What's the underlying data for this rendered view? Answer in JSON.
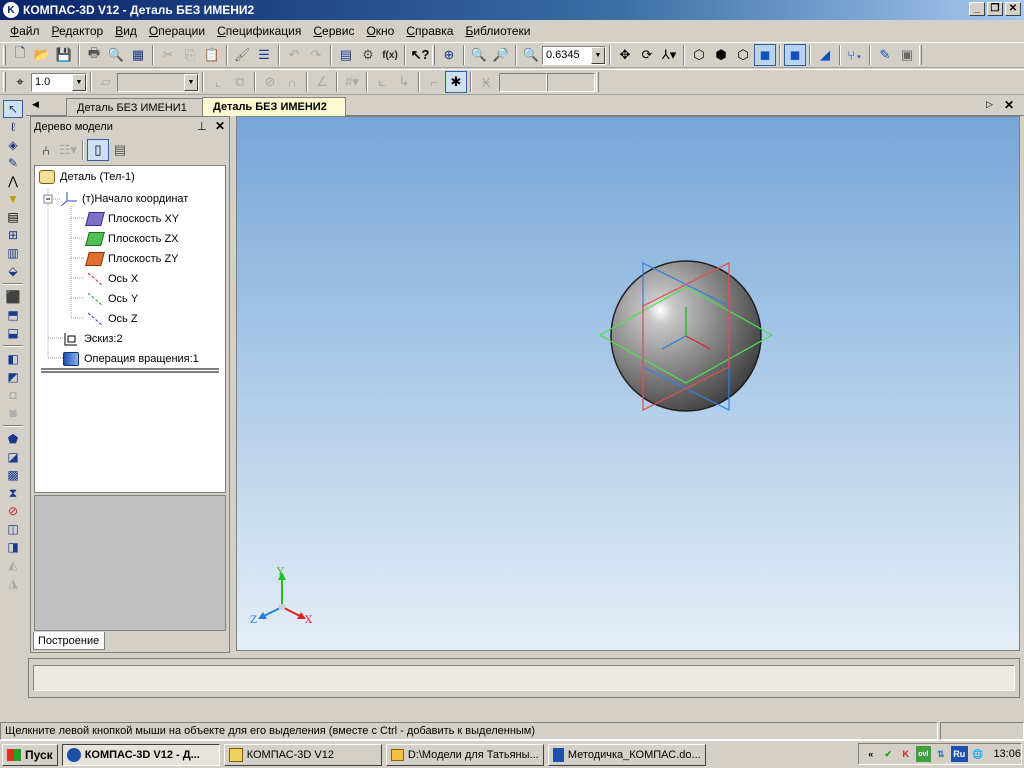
{
  "window": {
    "title": "КОМПАС-3D V12 - Деталь БЕЗ ИМЕНИ2",
    "min_icon": "minimize-icon",
    "restore_icon": "restore-icon",
    "close_icon": "close-icon"
  },
  "menubar": [
    {
      "first": "Ф",
      "rest": "айл"
    },
    {
      "first": "Р",
      "rest": "едактор"
    },
    {
      "first": "В",
      "rest": "ид"
    },
    {
      "first": "О",
      "rest": "перации"
    },
    {
      "first": "С",
      "rest": "пецификация"
    },
    {
      "first": "С",
      "rest": "ервис"
    },
    {
      "first": "О",
      "rest": "кно"
    },
    {
      "first": "С",
      "rest": "правка"
    },
    {
      "first": "Б",
      "rest": "иблиотеки"
    }
  ],
  "toolbar1": {
    "zoom_value": "0.6345",
    "fx_label": "f(x)"
  },
  "toolbar2": {
    "step_value": "1.0"
  },
  "tabs": {
    "tab1": "Деталь БЕЗ ИМЕНИ1",
    "tab2": "Деталь БЕЗ ИМЕНИ2"
  },
  "tree": {
    "title": "Дерево модели",
    "pin": "ф",
    "close": "✕",
    "root": "Деталь (Тел-1)",
    "origin": "(т)Начало координат",
    "plane_xy": "Плоскость XY",
    "plane_zx": "Плоскость ZX",
    "plane_zy": "Плоскость ZY",
    "axis_x": "Ось X",
    "axis_y": "Ось Y",
    "axis_z": "Ось Z",
    "sketch": "Эскиз:2",
    "rotation": "Операция вращения:1",
    "bottom_tab": "Построение"
  },
  "viewport": {
    "axis_x": "X",
    "axis_y": "Y",
    "axis_z": "Z",
    "colors": {
      "x": "#e02020",
      "y": "#20b020",
      "z": "#2080e0",
      "plane_xy": "#e05050",
      "plane_zx": "#4fe04f",
      "plane_zy": "#3080e0"
    }
  },
  "status": {
    "message": "Щелкните левой кнопкой мыши на объекте для его выделения (вместе с Ctrl - добавить к выделенным)"
  },
  "taskbar": {
    "start": "Пуск",
    "tasks": [
      "КОМПАС-3D V12 - Д...",
      "КОМПАС-3D V12",
      "D:\\Модели для Татьяны...",
      "Методичка_КОМПАС.do..."
    ],
    "lang": "Ru",
    "time": "13:06"
  }
}
